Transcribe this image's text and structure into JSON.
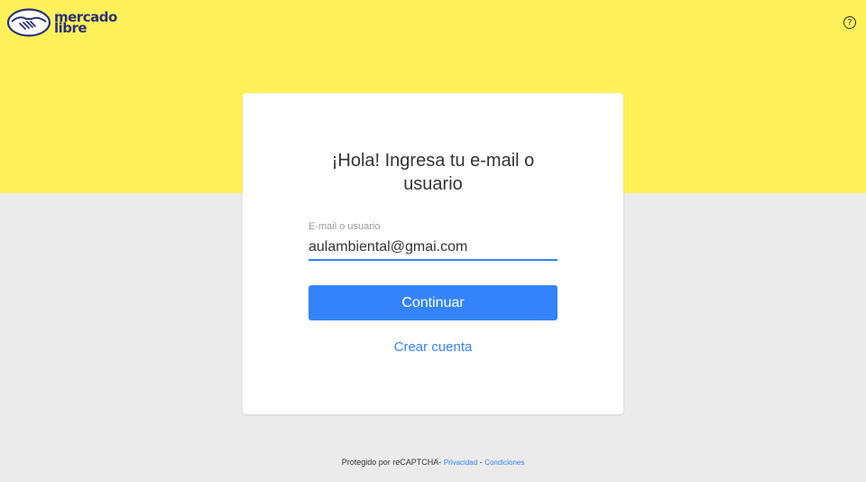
{
  "brand": {
    "line1": "mercado",
    "line2": "libre"
  },
  "header": {
    "help_icon": "?"
  },
  "login": {
    "title": "¡Hola! Ingresa tu e-mail o usuario",
    "field_label": "E-mail o usuario",
    "field_value": "aulambiental@gmai.com",
    "continue_label": "Continuar",
    "create_account_label": "Crear cuenta"
  },
  "footer": {
    "protected_text": "Protegido por reCAPTCHA-",
    "privacy_label": "Privacidad",
    "separator": "-",
    "terms_label": "Condiciones"
  },
  "colors": {
    "header_yellow": "#fff159",
    "background_gray": "#ebebeb",
    "accent_blue": "#3483fa",
    "brand_navy": "#2d3277"
  },
  "icons": {
    "logo": "handshake-icon",
    "help": "question-circle-icon"
  }
}
